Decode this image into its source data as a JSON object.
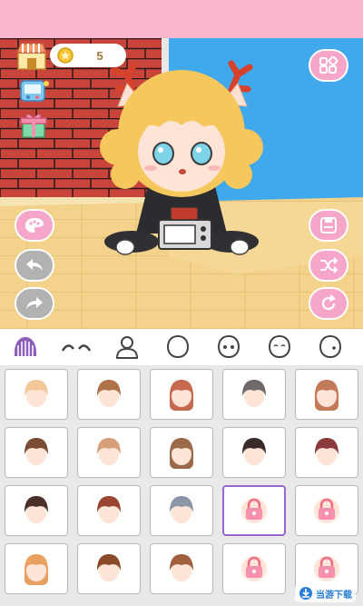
{
  "top_bar": {
    "color": "#f8b6cf"
  },
  "coins": {
    "count": "5",
    "icon": "star-coin-icon"
  },
  "colors": {
    "accent_pink": "#f6a6c9",
    "control_grey": "#b2b2b2",
    "brick": "#c9453c",
    "wall_blue": "#3fa9ec",
    "floor": "#f3d38c",
    "selected_border": "#9a66cf"
  },
  "left_buttons": [
    "shop-icon",
    "tv-game-icon",
    "gift-box-icon",
    "palette-icon",
    "undo-icon",
    "redo-icon"
  ],
  "right_buttons": [
    "grid-menu-icon",
    "save-icon",
    "shuffle-icon",
    "reset-icon"
  ],
  "tabs": [
    {
      "name": "hair-front-tab",
      "active": true
    },
    {
      "name": "eyebrows-tab",
      "active": false
    },
    {
      "name": "body-tab",
      "active": false
    },
    {
      "name": "head-shape-tab",
      "active": false
    },
    {
      "name": "eyes-tab",
      "active": false
    },
    {
      "name": "face-tab",
      "active": false
    },
    {
      "name": "side-face-tab",
      "active": false
    }
  ],
  "hair_items": [
    {
      "style": "short-blonde",
      "locked": false
    },
    {
      "style": "short-brown",
      "locked": false
    },
    {
      "style": "braids-red",
      "locked": false
    },
    {
      "style": "bowl-grey",
      "locked": false
    },
    {
      "style": "long-curly",
      "locked": false
    },
    {
      "style": "bun-brown",
      "locked": false
    },
    {
      "style": "short-tan",
      "locked": false
    },
    {
      "style": "long-straight",
      "locked": false
    },
    {
      "style": "bowl-dark",
      "locked": false
    },
    {
      "style": "short-maroon",
      "locked": false
    },
    {
      "style": "short-dark",
      "locked": false
    },
    {
      "style": "short-reddish",
      "locked": false
    },
    {
      "style": "bowl-silver",
      "locked": false
    },
    {
      "style": "locked",
      "locked": true,
      "selected": true
    },
    {
      "style": "locked",
      "locked": true
    },
    {
      "style": "long-orange",
      "locked": false
    },
    {
      "style": "short-chestnut",
      "locked": false
    },
    {
      "style": "fringe-brown",
      "locked": false
    },
    {
      "style": "locked",
      "locked": true
    },
    {
      "style": "locked",
      "locked": true
    }
  ],
  "watermark": {
    "text": "当游下载",
    "icon": "download-site-logo"
  }
}
